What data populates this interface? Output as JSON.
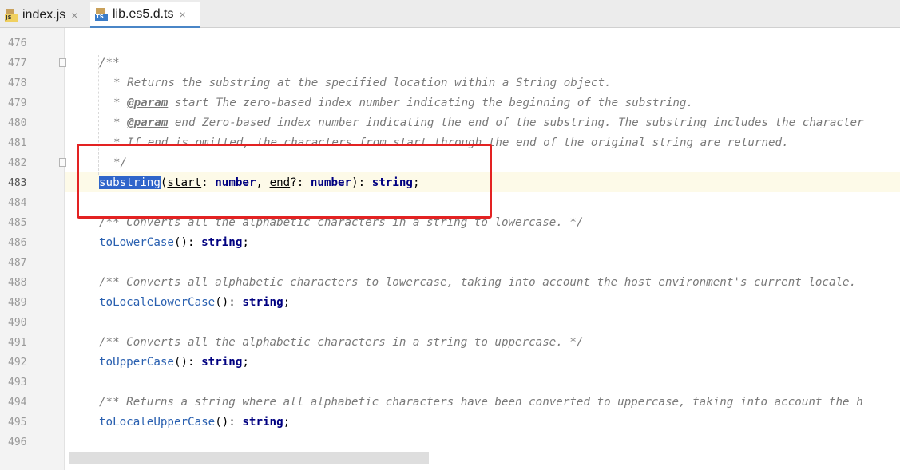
{
  "tabs": [
    {
      "label": "index.js",
      "icon": "js-file-icon",
      "active": false
    },
    {
      "label": "lib.es5.d.ts",
      "icon": "ts-file-icon",
      "active": true
    }
  ],
  "close_glyph": "×",
  "line_numbers": [
    "476",
    "477",
    "478",
    "479",
    "480",
    "481",
    "482",
    "483",
    "484",
    "485",
    "486",
    "487",
    "488",
    "489",
    "490",
    "491",
    "492",
    "493",
    "494",
    "495",
    "496"
  ],
  "code": {
    "l477": "/**",
    "l478": "* Returns the substring at the specified location within a String object.",
    "l479_tag": "@param",
    "l479_text": " start The zero-based index number indicating the beginning of the substring.",
    "l480_tag": "@param",
    "l480_text": " end Zero-based index number indicating the end of the substring. The substring includes the character",
    "l481": "* If end is omitted, the characters from start through the end of the original string are returned.",
    "l482": "*/",
    "l483_method": "substring",
    "l483_p1": "start",
    "l483_p2": "end",
    "l485": "/** Converts all the alphabetic characters in a string to lowercase. */",
    "l486": "toLowerCase",
    "l488": "/** Converts all alphabetic characters to lowercase, taking into account the host environment's current locale.",
    "l489": "toLocaleLowerCase",
    "l491": "/** Converts all the alphabetic characters in a string to uppercase. */",
    "l492": "toUpperCase",
    "l494": "/** Returns a string where all alphabetic characters have been converted to uppercase, taking into account the h",
    "l495": "toLocaleUpperCase",
    "type_number": "number",
    "type_string": "string"
  },
  "colors": {
    "highlight_box": "#e32222",
    "selection": "#2f65ca",
    "keyword": "#000080"
  }
}
